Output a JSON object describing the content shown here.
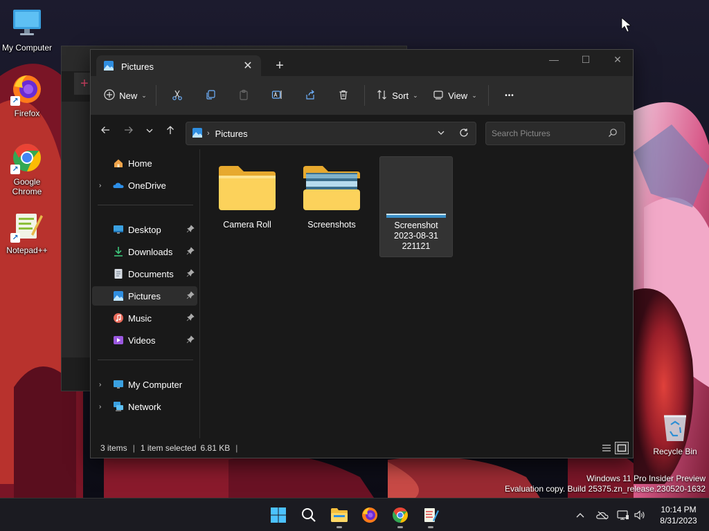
{
  "desktop": {
    "icons": [
      {
        "label": "My Computer",
        "icon": "monitor-icon"
      },
      {
        "label": "Firefox",
        "icon": "firefox-icon"
      },
      {
        "label": "Google Chrome",
        "icon": "chrome-icon"
      },
      {
        "label": "Notepad++",
        "icon": "notepadpp-icon"
      }
    ],
    "recycle_bin": "Recycle Bin",
    "watermark": {
      "line1": "Windows 11 Pro Insider Preview",
      "line2": "Evaluation copy. Build 25375.zn_release.230520-1632"
    }
  },
  "explorer": {
    "tab": {
      "title": "Pictures",
      "close": "✕",
      "new_tab": "+"
    },
    "window_controls": {
      "minimize": "—",
      "maximize": "☐",
      "close": "✕"
    },
    "toolbar": {
      "new_label": "New",
      "sort_label": "Sort",
      "view_label": "View",
      "more": "•••"
    },
    "address": {
      "crumb": "Pictures"
    },
    "search": {
      "placeholder": "Search Pictures"
    },
    "nav": {
      "home": "Home",
      "onedrive": "OneDrive",
      "quick": [
        {
          "label": "Desktop",
          "icon": "desktop-icon"
        },
        {
          "label": "Downloads",
          "icon": "downloads-icon"
        },
        {
          "label": "Documents",
          "icon": "documents-icon"
        },
        {
          "label": "Pictures",
          "icon": "pictures-icon",
          "selected": true
        },
        {
          "label": "Music",
          "icon": "music-icon"
        },
        {
          "label": "Videos",
          "icon": "videos-icon"
        }
      ],
      "my_computer": "My Computer",
      "network": "Network"
    },
    "files": [
      {
        "name": "Camera Roll",
        "type": "folder"
      },
      {
        "name": "Screenshots",
        "type": "folder-with-preview"
      },
      {
        "name_lines": [
          "Screenshot",
          "2023-08-31",
          "221121"
        ],
        "type": "image",
        "selected": true
      }
    ],
    "status": {
      "count": "3 items",
      "selection": "1 item selected",
      "size": "6.81 KB"
    }
  },
  "taskbar": {
    "apps": [
      "start-icon",
      "search-icon",
      "file-explorer-icon",
      "firefox-icon",
      "chrome-icon",
      "notepadpp-icon"
    ],
    "clock": {
      "time": "10:14 PM",
      "date": "8/31/2023"
    }
  }
}
